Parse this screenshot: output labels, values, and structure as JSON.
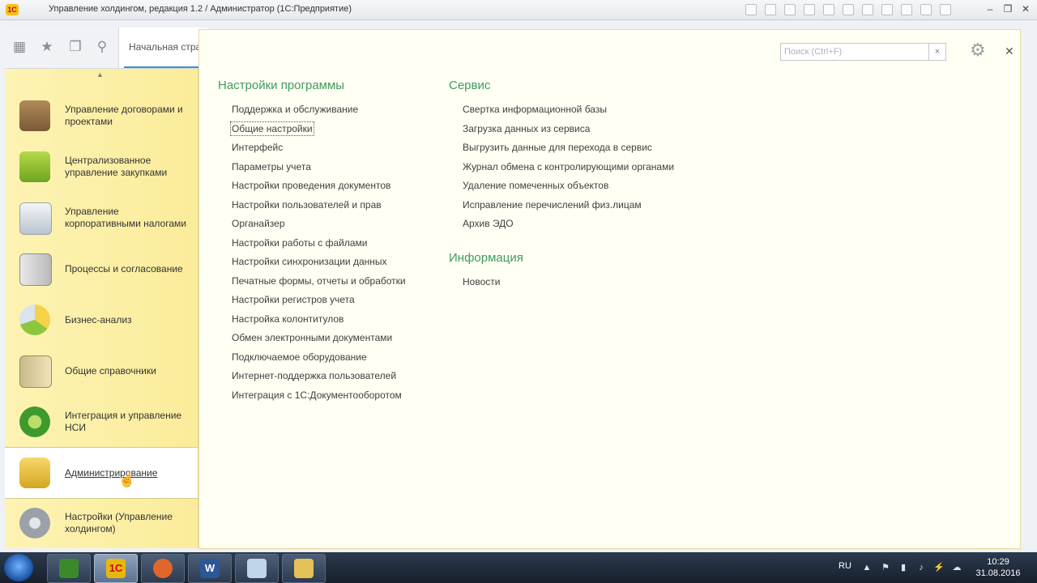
{
  "window": {
    "title": "Управление холдингом, редакция 1.2 / Администратор  (1С:Предприятие)",
    "logo_text": "1С",
    "controls": {
      "minimize": "–",
      "restore": "❐",
      "close": "✕"
    }
  },
  "toolbar": {
    "home_tab": "Начальная стра",
    "icons": [
      "apps-grid-icon",
      "star-icon",
      "history-icon",
      "search-icon"
    ]
  },
  "sidebar": {
    "scroll_up": "▲",
    "items": [
      {
        "label": "Управление договорами и проектами",
        "icon": "briefcase-icon"
      },
      {
        "label": "Централизованное управление закупками",
        "icon": "gift-box-icon"
      },
      {
        "label": "Управление корпоративными налогами",
        "icon": "documents-icon"
      },
      {
        "label": "Процессы и согласование",
        "icon": "process-chart-icon"
      },
      {
        "label": "Бизнес-анализ",
        "icon": "pie-chart-icon"
      },
      {
        "label": "Общие справочники",
        "icon": "book-icon"
      },
      {
        "label": "Интеграция и управление НСИ",
        "icon": "sync-icon"
      },
      {
        "label": "Администрирование",
        "icon": "database-computer-icon",
        "active": true
      },
      {
        "label": "Настройки (Управление холдингом)",
        "icon": "gears-icon"
      }
    ]
  },
  "panel": {
    "search_placeholder": "Поиск (Ctrl+F)",
    "search_value": "",
    "clear_label": "×",
    "close_label": "✕",
    "sections": {
      "settings": {
        "title": "Настройки программы",
        "links": [
          "Поддержка и обслуживание",
          "Общие настройки",
          "Интерфейс",
          "Параметры учета",
          "Настройки проведения документов",
          "Настройки пользователей и прав",
          "Органайзер",
          "Настройки работы с файлами",
          "Настройки синхронизации данных",
          "Печатные формы, отчеты и обработки",
          "Настройки регистров учета",
          "Настройка колонтитулов",
          "Обмен электронными документами",
          "Подключаемое оборудование",
          "Интернет-поддержка пользователей",
          "Интеграция с 1С:Документооборотом"
        ]
      },
      "service": {
        "title": "Сервис",
        "links": [
          "Свертка информационной базы",
          "Загрузка данных из сервиса",
          "Выгрузить данные для перехода в сервис",
          "Журнал обмена с контролирующими органами",
          "Удаление помеченных объектов",
          "Исправление перечислений физ.лицам",
          "Архив ЭДО"
        ]
      },
      "info": {
        "title": "Информация",
        "links": [
          "Новости"
        ]
      }
    }
  },
  "taskbar": {
    "apps": [
      {
        "icon": "tree-app-icon",
        "glyph": "",
        "color": "#3a8a2a"
      },
      {
        "icon": "1c-app-icon",
        "glyph": "1С",
        "color": "#e8b70c",
        "active": true
      },
      {
        "icon": "firefox-icon",
        "glyph": "",
        "color": "#e0662a"
      },
      {
        "icon": "word-icon",
        "glyph": "W",
        "color": "#2b5797"
      },
      {
        "icon": "paint-icon",
        "glyph": "",
        "color": "#c0d4ea"
      },
      {
        "icon": "folder-icon",
        "glyph": "",
        "color": "#e6c15a"
      }
    ],
    "lang": "RU",
    "time": "10:29",
    "date": "31.08.2016"
  }
}
